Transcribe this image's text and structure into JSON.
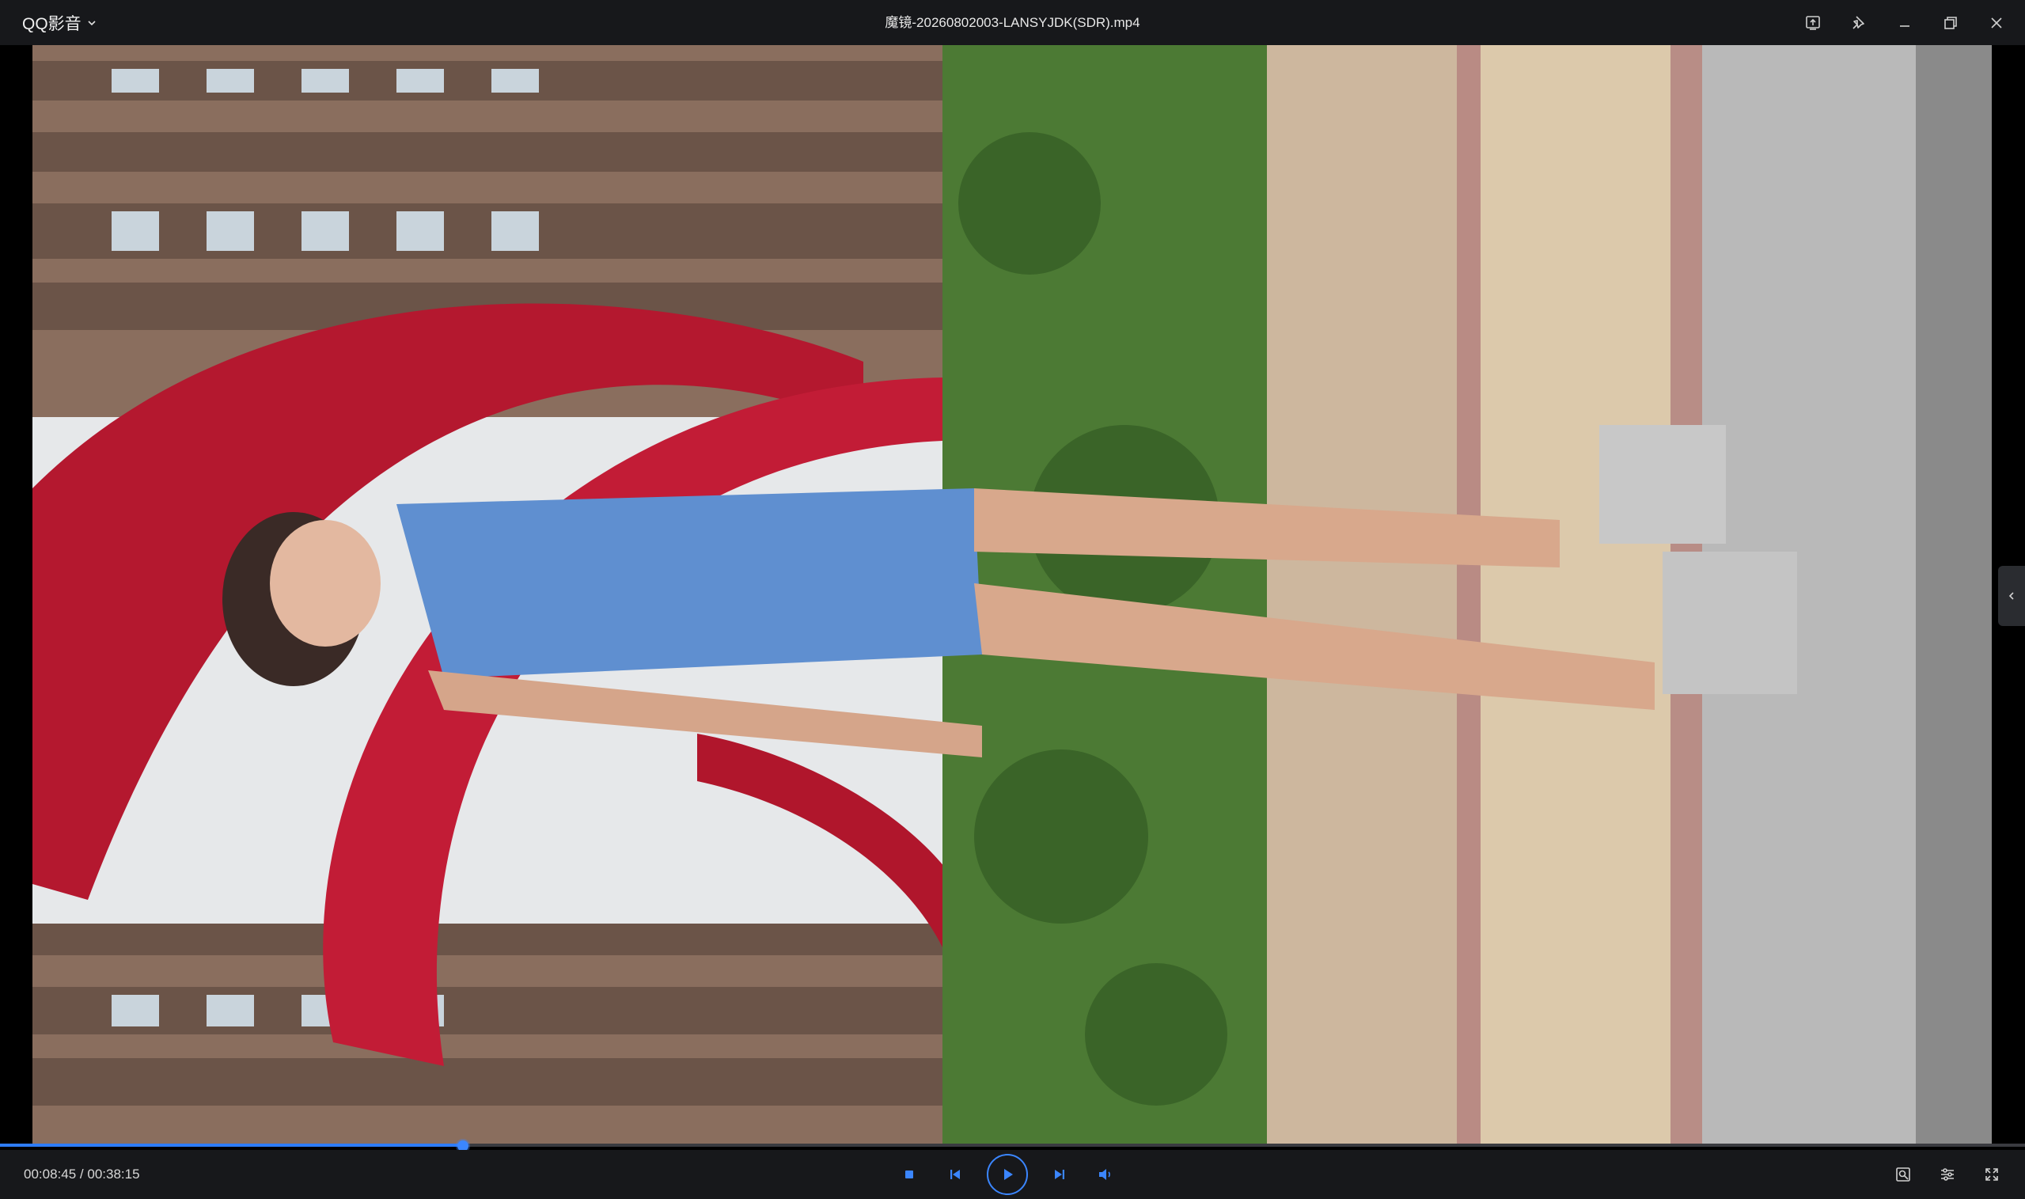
{
  "app": {
    "brand": "QQ影音",
    "file_title": "魔镜-20260802003-LANSYJDK(SDR).mp4"
  },
  "titlebar": {
    "buttons": [
      {
        "name": "screen-mirror-icon"
      },
      {
        "name": "pin-icon"
      },
      {
        "name": "minimize-icon"
      },
      {
        "name": "restore-icon"
      },
      {
        "name": "close-icon"
      }
    ]
  },
  "player": {
    "current_time": "00:08:45",
    "separator": "/",
    "total_time": "00:38:15",
    "progress_fraction": 0.2288
  },
  "controls": {
    "center": [
      "stop-icon",
      "previous-icon",
      "play-icon",
      "next-icon",
      "volume-icon"
    ],
    "right": [
      "screenshot-icon",
      "settings-icon",
      "fullscreen-icon"
    ]
  },
  "colors": {
    "accent": "#2e7cf6",
    "bar_bg": "#17181b",
    "icon": "#3b86ff"
  }
}
